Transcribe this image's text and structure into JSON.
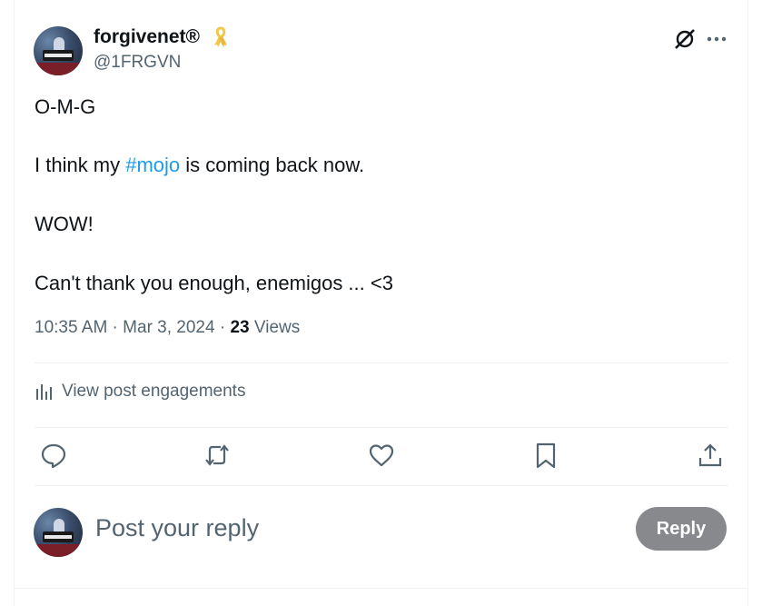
{
  "author": {
    "display_name": "forgivenet®",
    "handle": "@1FRGVN"
  },
  "post": {
    "line1": "O-M-G",
    "line2_before": "I think my ",
    "line2_hashtag": "#mojo",
    "line2_after": " is coming back now.",
    "line3": "WOW!",
    "line4": "Can't thank you enough, enemigos ... <3"
  },
  "meta": {
    "time": "10:35 AM",
    "separator": " · ",
    "date": "Mar 3, 2024",
    "views_count": "23",
    "views_label": " Views"
  },
  "engagements": {
    "label": "View post engagements"
  },
  "actions": [
    "reply-icon",
    "repost-icon",
    "like-icon",
    "bookmark-icon",
    "share-icon"
  ],
  "reply_box": {
    "placeholder": "Post your reply",
    "button_label": "Reply"
  },
  "colors": {
    "accent": "#1d9bf0",
    "secondary_text": "#536471",
    "reply_button_bg": "#87898c",
    "badge": "#f3c747"
  }
}
